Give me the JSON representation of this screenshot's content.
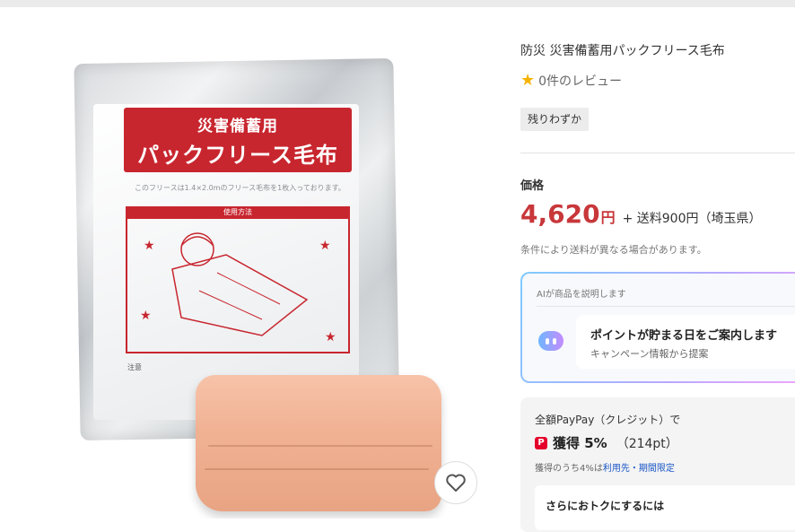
{
  "product": {
    "package_title_line1": "災害備蓄用",
    "package_title_line2": "パックフリース毛布",
    "package_desc": "このフリースは1.4×2.0mのフリース毛布を1枚入っております。",
    "package_usage": "使用方法",
    "package_note": "注意"
  },
  "info": {
    "title": "防災 災害備蓄用パックフリース毛布",
    "review_text": "0件のレビュー",
    "stock_badge": "残りわずか",
    "price_label": "価格",
    "price": "4,620",
    "price_unit": "円",
    "shipping": "+ 送料900円（埼玉県）",
    "shipping_note": "条件により送料が異なる場合があります。"
  },
  "ai": {
    "header": "AIが商品を説明します",
    "message": "ポイントが貯まる日をご案内します",
    "sub": "キャンペーン情報から提案"
  },
  "pay": {
    "line1": "全額PayPay（クレジット）で",
    "get_label": "獲得 5%",
    "points": "（214pt）",
    "detail_prefix": "獲得のうち4%は",
    "detail_link": "利用先・期間限定",
    "more_title": "さらにおトクにするには"
  },
  "colors": {
    "price": "#c8373a",
    "banner_red": "#c8262f",
    "link": "#1a56c6",
    "star": "#f5b300"
  },
  "icons": {
    "favorite": "heart-icon",
    "rating": "star-icon",
    "ai": "ai-bot-icon",
    "paypay": "paypay-icon"
  }
}
